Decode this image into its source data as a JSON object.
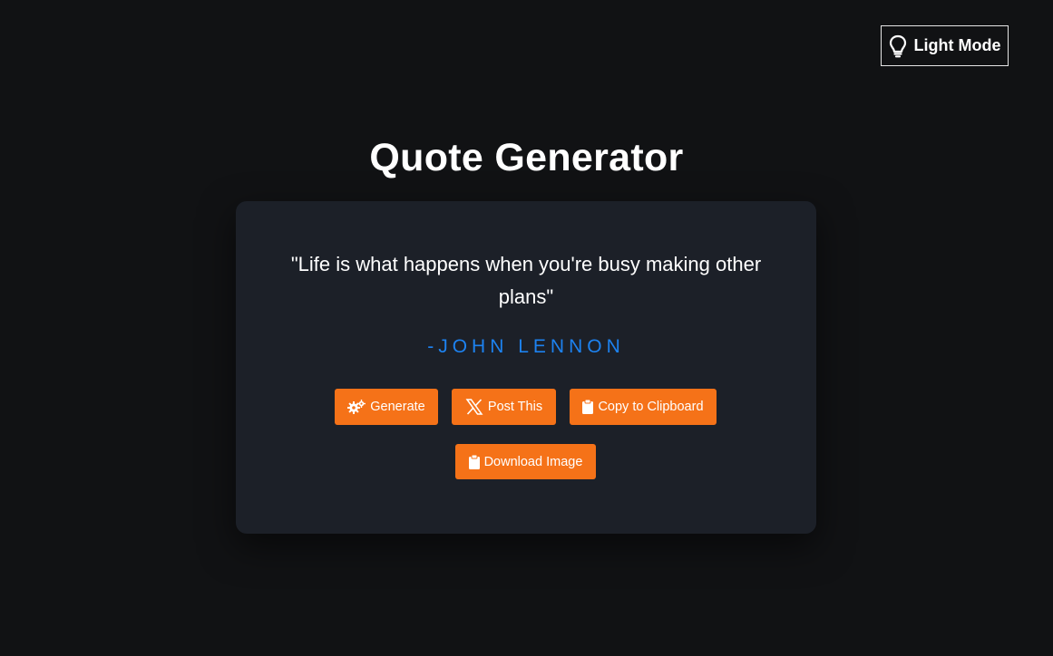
{
  "header": {
    "theme_toggle_label": "Light Mode",
    "theme_icon": "lightbulb-icon"
  },
  "main": {
    "title": "Quote Generator",
    "quote": "\"Life is what happens when you're busy making other plans\"",
    "author": "-JOHN LENNON"
  },
  "actions": {
    "generate_label": "Generate",
    "generate_icon": "gears-icon",
    "post_label": "Post This",
    "post_icon": "x-logo-icon",
    "copy_label": "Copy to Clipboard",
    "copy_icon": "clipboard-icon",
    "download_label": "Download Image",
    "download_icon": "clipboard-icon"
  },
  "colors": {
    "background": "#111214",
    "card": "#1c2028",
    "accent_button": "#f57218",
    "author_text": "#1d82f0"
  }
}
